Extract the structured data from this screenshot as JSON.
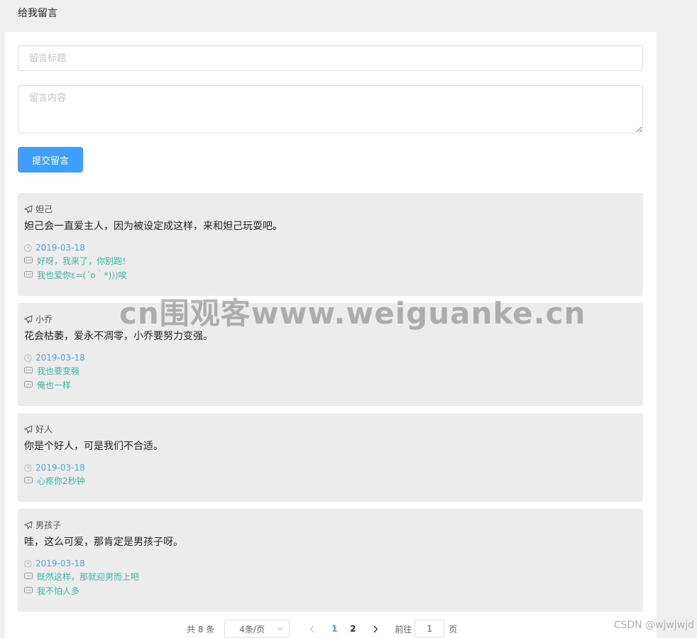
{
  "header": {
    "title": "给我留言"
  },
  "form": {
    "title_placeholder": "留言标题",
    "content_placeholder": "留言内容",
    "submit_label": "提交留言"
  },
  "messages": [
    {
      "author": "妲己",
      "content": "妲己会一直爱主人，因为被设定成这样，来和妲己玩耍吧。",
      "date": "2019-03-18",
      "replies": [
        "好呀，我来了，你别跑！",
        "我也爱你ε=(´ο｀*)))唉"
      ]
    },
    {
      "author": "小乔",
      "content": "花会枯萎，爱永不凋零，小乔要努力变强。",
      "date": "2019-03-18",
      "replies": [
        "我也要变强",
        "俺也一样"
      ]
    },
    {
      "author": "好人",
      "content": "你是个好人，可是我们不合适。",
      "date": "2019-03-18",
      "replies": [
        "心疼你2秒钟"
      ]
    },
    {
      "author": "男孩子",
      "content": "哇，这么可爱，那肯定是男孩子呀。",
      "date": "2019-03-18",
      "replies": [
        "既然这样，那就迎男而上吧",
        "我不怕人多"
      ]
    }
  ],
  "pagination": {
    "total_label": "共 8 条",
    "page_size": "4条/页",
    "pages": [
      "1",
      "2"
    ],
    "current_page": "1",
    "goto_label": "前往",
    "goto_value": "1",
    "page_suffix": "页"
  },
  "watermark": "cn围观客www.weiguanke.cn",
  "csdn_watermark": "CSDN @wjwjwjd",
  "colors": {
    "primary": "#409eff",
    "date": "#5aa3d8",
    "reply": "#3db6a4",
    "card_bg": "#ececec"
  }
}
